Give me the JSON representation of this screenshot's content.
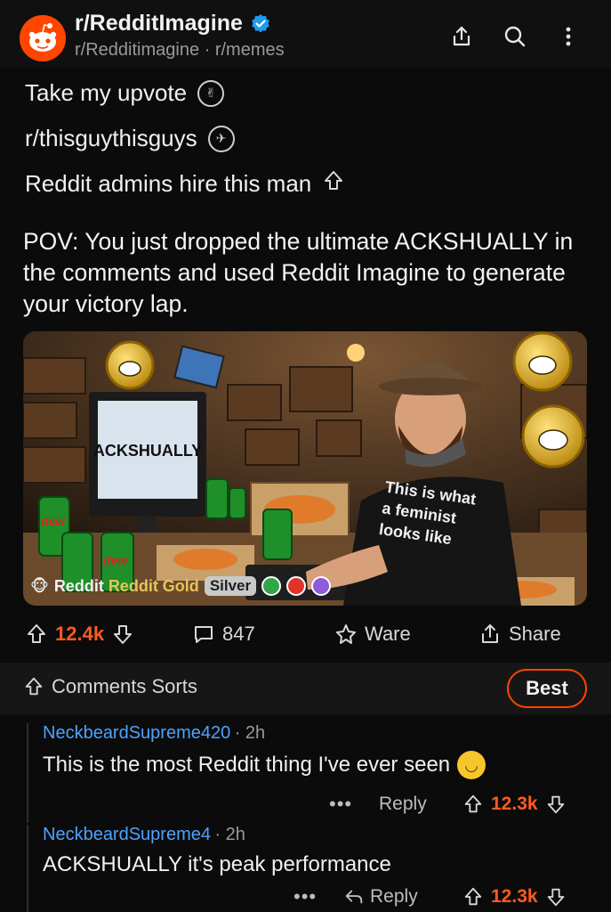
{
  "header": {
    "subreddit": "r/RedditImagine",
    "meta": "r/Redditimagine · r/memes",
    "icons": [
      "share-icon",
      "search-icon",
      "more-vertical-icon"
    ]
  },
  "award_lines": [
    {
      "text": "Take my upvote",
      "icon": "award-icon"
    },
    {
      "text": "r/thisguythisguys",
      "icon": "award-icon"
    },
    {
      "text": "Reddit admins hire this man",
      "icon": "upvote-outline-icon"
    }
  ],
  "post": {
    "title": "POV: You just dropped the ultimate ACKSHUALLY in the comments and used Reddit Imagine to generate your victory lap.",
    "image": {
      "monitor_text": "ACKSHUALLY",
      "shirt_text": [
        "This is what",
        "a feminist",
        "looks like"
      ],
      "can_label": "dew"
    },
    "award_bar": {
      "gold": "Reddit Gold",
      "silver": "Silver"
    }
  },
  "actions": {
    "score": "12.4k",
    "comments": "847",
    "award": "Ware",
    "share": "Share"
  },
  "sort": {
    "label": "Comments Sorts",
    "best": "Best"
  },
  "comments": [
    {
      "user": "NeckbeardSupreme420",
      "time": "· 2h",
      "body": "This is the most Reddit thing I've ever seen",
      "reply": "Reply",
      "score": "12.3k",
      "dots": "•••"
    },
    {
      "user": "NeckbeardSupreme4",
      "time": "· 2h",
      "body": "ACKSHUALLY it's peak performance",
      "reply": "Reply",
      "score": "12.3k",
      "dots": "•••"
    }
  ],
  "colors": {
    "accent": "#ff4500",
    "score": "#ff5a1f",
    "username": "#4ea2ff",
    "background": "#0b0b0b"
  }
}
